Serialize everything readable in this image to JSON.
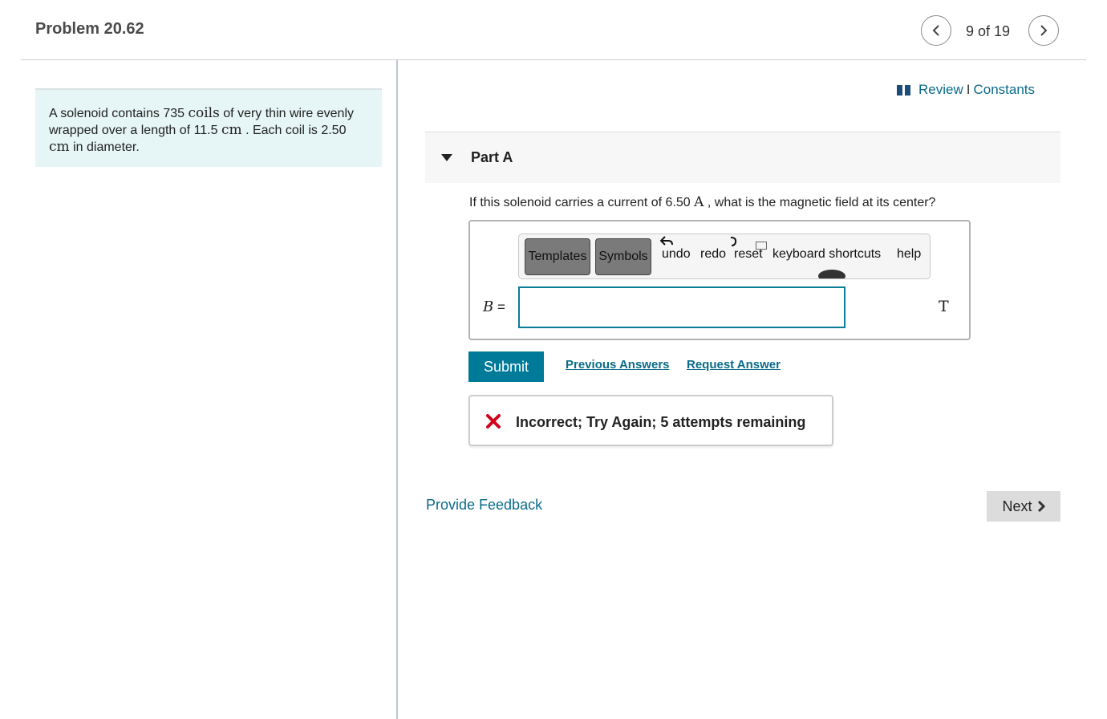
{
  "header": {
    "title": "Problem 20.62",
    "position": "9 of 19"
  },
  "intro": {
    "text_a": "A solenoid contains 735 ",
    "unit_coils": "coils",
    "text_b": " of very thin wire evenly wrapped over a length of 11.5 ",
    "unit_cm_a": "cm",
    "text_c": " . Each coil is 2.50 ",
    "unit_cm_b": "cm",
    "text_d": " in diameter."
  },
  "links": {
    "review": "Review",
    "separator": "I",
    "constants": "Constants"
  },
  "part": {
    "title": "Part A",
    "question_a": "If this solenoid carries a current of 6.50 ",
    "question_unit": "A",
    "question_b": " , what is the magnetic field at its center?"
  },
  "toolbar": {
    "templates": "Templates",
    "symbols": "Symbols",
    "undo": "undo",
    "redo": "redo",
    "reset": "reset",
    "shortcuts": "keyboard shortcuts",
    "help": "help"
  },
  "answer": {
    "variable": "B",
    "equals": " =",
    "value": "",
    "unit": "T"
  },
  "actions": {
    "submit": "Submit",
    "previous_answers": "Previous Answers",
    "request_answer": "Request Answer"
  },
  "feedback": {
    "message": "Incorrect; Try Again; 5 attempts remaining"
  },
  "footer": {
    "provide_feedback": "Provide Feedback",
    "next": "Next"
  },
  "colors": {
    "accent": "#007a99",
    "link": "#0a6b8a",
    "error": "#d0021b",
    "intro_bg": "#e6f5f5"
  }
}
